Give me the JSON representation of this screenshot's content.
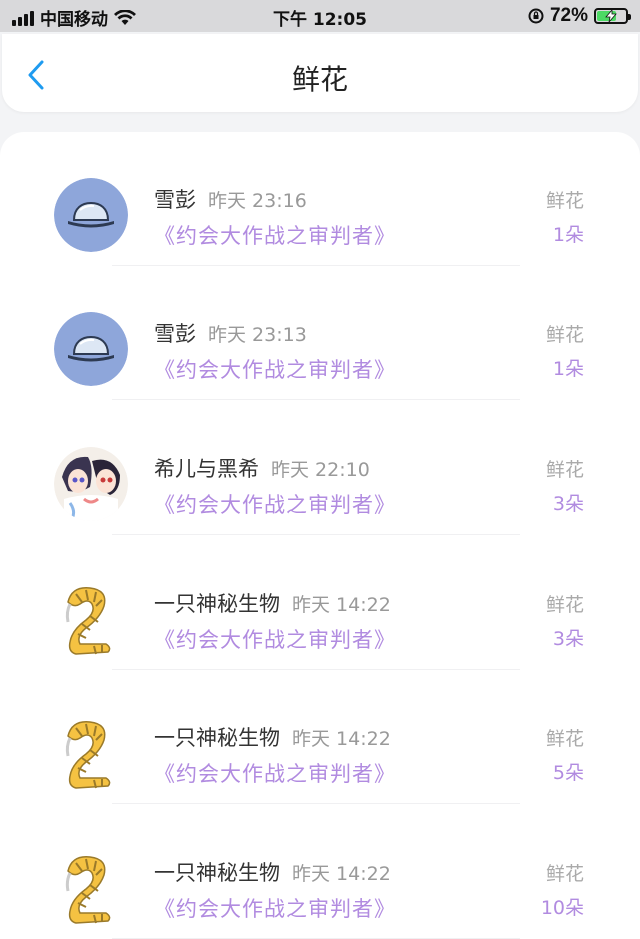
{
  "status_bar": {
    "carrier": "中国移动",
    "time": "下午 12:05",
    "battery": "72%",
    "battery_level": 0.72
  },
  "header": {
    "title": "鲜花",
    "back_icon": "chevron-left-icon"
  },
  "colors": {
    "accent": "#b18be0",
    "back": "#1e9bf0",
    "avatar_blue": "#8ea6da"
  },
  "list": [
    {
      "name": "雪彭",
      "time": "昨天 23:16",
      "book": "《约会大作战之审判者》",
      "gift": "鲜花",
      "count": "1朵",
      "avatar": "hat"
    },
    {
      "name": "雪彭",
      "time": "昨天 23:13",
      "book": "《约会大作战之审判者》",
      "gift": "鲜花",
      "count": "1朵",
      "avatar": "hat"
    },
    {
      "name": "希儿与黑希",
      "time": "昨天 22:10",
      "book": "《约会大作战之审判者》",
      "gift": "鲜花",
      "count": "3朵",
      "avatar": "anime"
    },
    {
      "name": "一只神秘生物",
      "time": "昨天 14:22",
      "book": "《约会大作战之审判者》",
      "gift": "鲜花",
      "count": "3朵",
      "avatar": "creature"
    },
    {
      "name": "一只神秘生物",
      "time": "昨天 14:22",
      "book": "《约会大作战之审判者》",
      "gift": "鲜花",
      "count": "5朵",
      "avatar": "creature"
    },
    {
      "name": "一只神秘生物",
      "time": "昨天 14:22",
      "book": "《约会大作战之审判者》",
      "gift": "鲜花",
      "count": "10朵",
      "avatar": "creature"
    }
  ]
}
